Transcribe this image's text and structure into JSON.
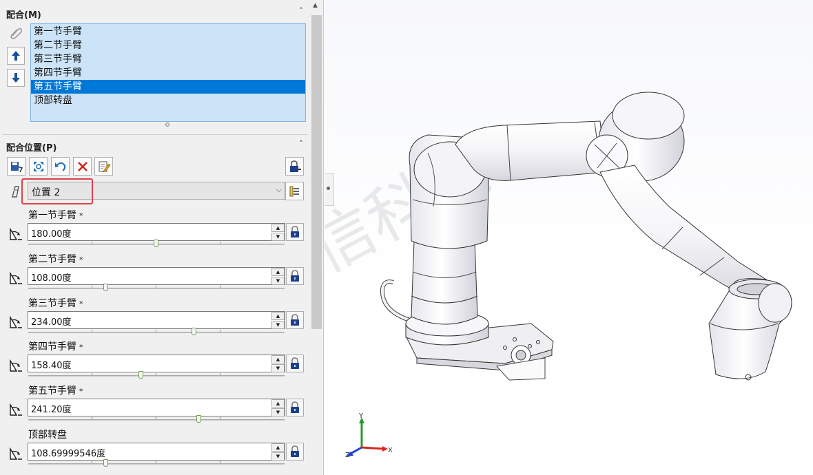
{
  "mates_section": {
    "title": "配合(M)",
    "items": [
      "第一节手臂",
      "第二节手臂",
      "第三节手臂",
      "第四节手臂",
      "第五节手臂",
      "顶部转盘"
    ],
    "selected_index": 4
  },
  "positions_section": {
    "title": "配合位置(P)",
    "current_position": "位置 2"
  },
  "joints": [
    {
      "label": "第一节手臂",
      "required_mark": "*",
      "value": "180.00度",
      "slider_fraction": 0.5
    },
    {
      "label": "第二节手臂",
      "required_mark": "*",
      "value": "108.00度",
      "slider_fraction": 0.3
    },
    {
      "label": "第三节手臂",
      "required_mark": "*",
      "value": "234.00度",
      "slider_fraction": 0.65
    },
    {
      "label": "第四节手臂",
      "required_mark": "*",
      "value": "158.40度",
      "slider_fraction": 0.44
    },
    {
      "label": "第五节手臂",
      "required_mark": "*",
      "value": "241.20度",
      "slider_fraction": 0.67
    },
    {
      "label": "顶部转盘",
      "required_mark": "",
      "value": "108.69999546度",
      "slider_fraction": 0.3
    }
  ],
  "triad": {
    "x": "X",
    "y": "Y",
    "z": "Z"
  },
  "watermark": "华信科技",
  "colors": {
    "selection": "#0078d7",
    "list_background": "#cce4f7",
    "highlight_box": "#e0414a",
    "axis_x": "#d9261c",
    "axis_y": "#2a9a2a",
    "axis_z": "#1f3fd6"
  },
  "icons": {
    "mate_icon": "paperclip-icon",
    "move_up": "arrow-up-icon",
    "move_down": "arrow-down-icon",
    "lock": "lock-icon"
  }
}
